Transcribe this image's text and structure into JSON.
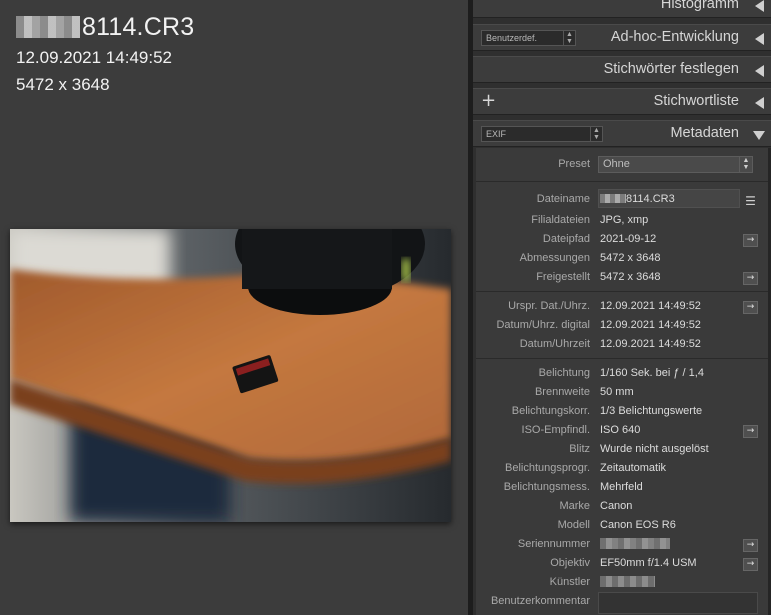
{
  "overlay": {
    "filename_suffix": "8114.CR3",
    "date": "12.09.2021 14:49:52",
    "dimensions": "5472 x 3648"
  },
  "panels": {
    "histogram": {
      "title": "Histogramm"
    },
    "quick_develop": {
      "title": "Ad-hoc-Entwicklung",
      "preset_value": "Benutzerdef."
    },
    "keywording": {
      "title": "Stichwörter festlegen"
    },
    "keyword_list": {
      "title": "Stichwortliste",
      "add_symbol": "+"
    },
    "metadata": {
      "title": "Metadaten",
      "view_value": "EXIF"
    }
  },
  "metadata": {
    "preset_label": "Preset",
    "preset_value": "Ohne",
    "fields": {
      "filename": {
        "label": "Dateiname",
        "value_suffix": "8114.CR3"
      },
      "sidecar": {
        "label": "Filialdateien",
        "value": "JPG, xmp"
      },
      "folder": {
        "label": "Dateipfad",
        "value": "2021-09-12"
      },
      "dimensions": {
        "label": "Abmessungen",
        "value": "5472 x 3648"
      },
      "cropped": {
        "label": "Freigestellt",
        "value": "5472 x 3648"
      },
      "orig_date": {
        "label": "Urspr. Dat./Uhrz.",
        "value": "12.09.2021 14:49:52"
      },
      "digitized": {
        "label": "Datum/Uhrz. digital",
        "value": "12.09.2021 14:49:52"
      },
      "date_time": {
        "label": "Datum/Uhrzeit",
        "value": "12.09.2021 14:49:52"
      },
      "exposure": {
        "label": "Belichtung",
        "value": "1/160 Sek. bei ƒ / 1,4"
      },
      "focal": {
        "label": "Brennweite",
        "value": "50 mm"
      },
      "exp_bias": {
        "label": "Belichtungskorr.",
        "value": "1/3 Belichtungswerte"
      },
      "iso": {
        "label": "ISO-Empfindl.",
        "value": "ISO 640"
      },
      "flash": {
        "label": "Blitz",
        "value": "Wurde nicht ausgelöst"
      },
      "exp_program": {
        "label": "Belichtungsprogr.",
        "value": "Zeitautomatik"
      },
      "metering": {
        "label": "Belichtungsmess.",
        "value": "Mehrfeld"
      },
      "make": {
        "label": "Marke",
        "value": "Canon"
      },
      "model": {
        "label": "Modell",
        "value": "Canon EOS R6"
      },
      "serial": {
        "label": "Seriennummer"
      },
      "lens": {
        "label": "Objektiv",
        "value": "EF50mm f/1.4 USM"
      },
      "artist": {
        "label": "Künstler"
      },
      "user_comment": {
        "label": "Benutzerkommentar"
      }
    },
    "goto_arrow": "→",
    "list_icon": "☰"
  },
  "icon_names": [
    "collapse-left-triangle",
    "expand-down-triangle",
    "goto-arrow-icon",
    "list-icon",
    "spin-updown-icon"
  ],
  "colors": {
    "panel_bg": "#2f2f2f",
    "header_bg": "#3c3c3c",
    "viewer_bg": "#3c3c3c",
    "text": "#dcdcdc",
    "label": "#a9a9a9"
  }
}
